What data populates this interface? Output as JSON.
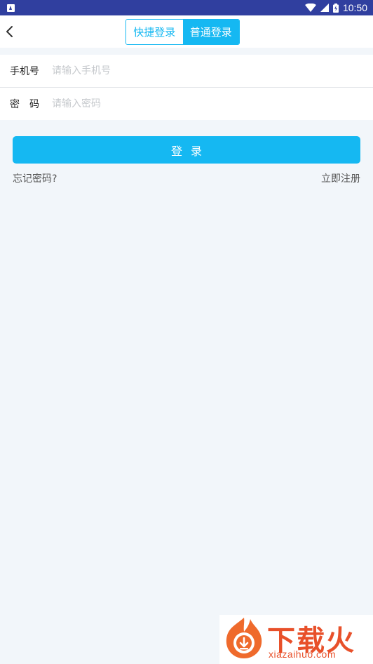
{
  "status_bar": {
    "time": "10:50"
  },
  "header": {
    "tabs": [
      {
        "label": "快捷登录",
        "active": false
      },
      {
        "label": "普通登录",
        "active": true
      }
    ]
  },
  "form": {
    "phone": {
      "label": "手机号",
      "placeholder": "请输入手机号",
      "value": ""
    },
    "password": {
      "label": "密码",
      "placeholder": "请输入密码",
      "value": ""
    }
  },
  "actions": {
    "login_label": "登录",
    "forgot_label": "忘记密码?",
    "register_label": "立即注册"
  },
  "watermark": {
    "title": "下载火",
    "url": "xiazaihuo.com"
  },
  "colors": {
    "accent": "#15b8f2",
    "status_bar": "#303f9f",
    "page_bg": "#f2f6fa",
    "watermark": "#e8502a"
  }
}
